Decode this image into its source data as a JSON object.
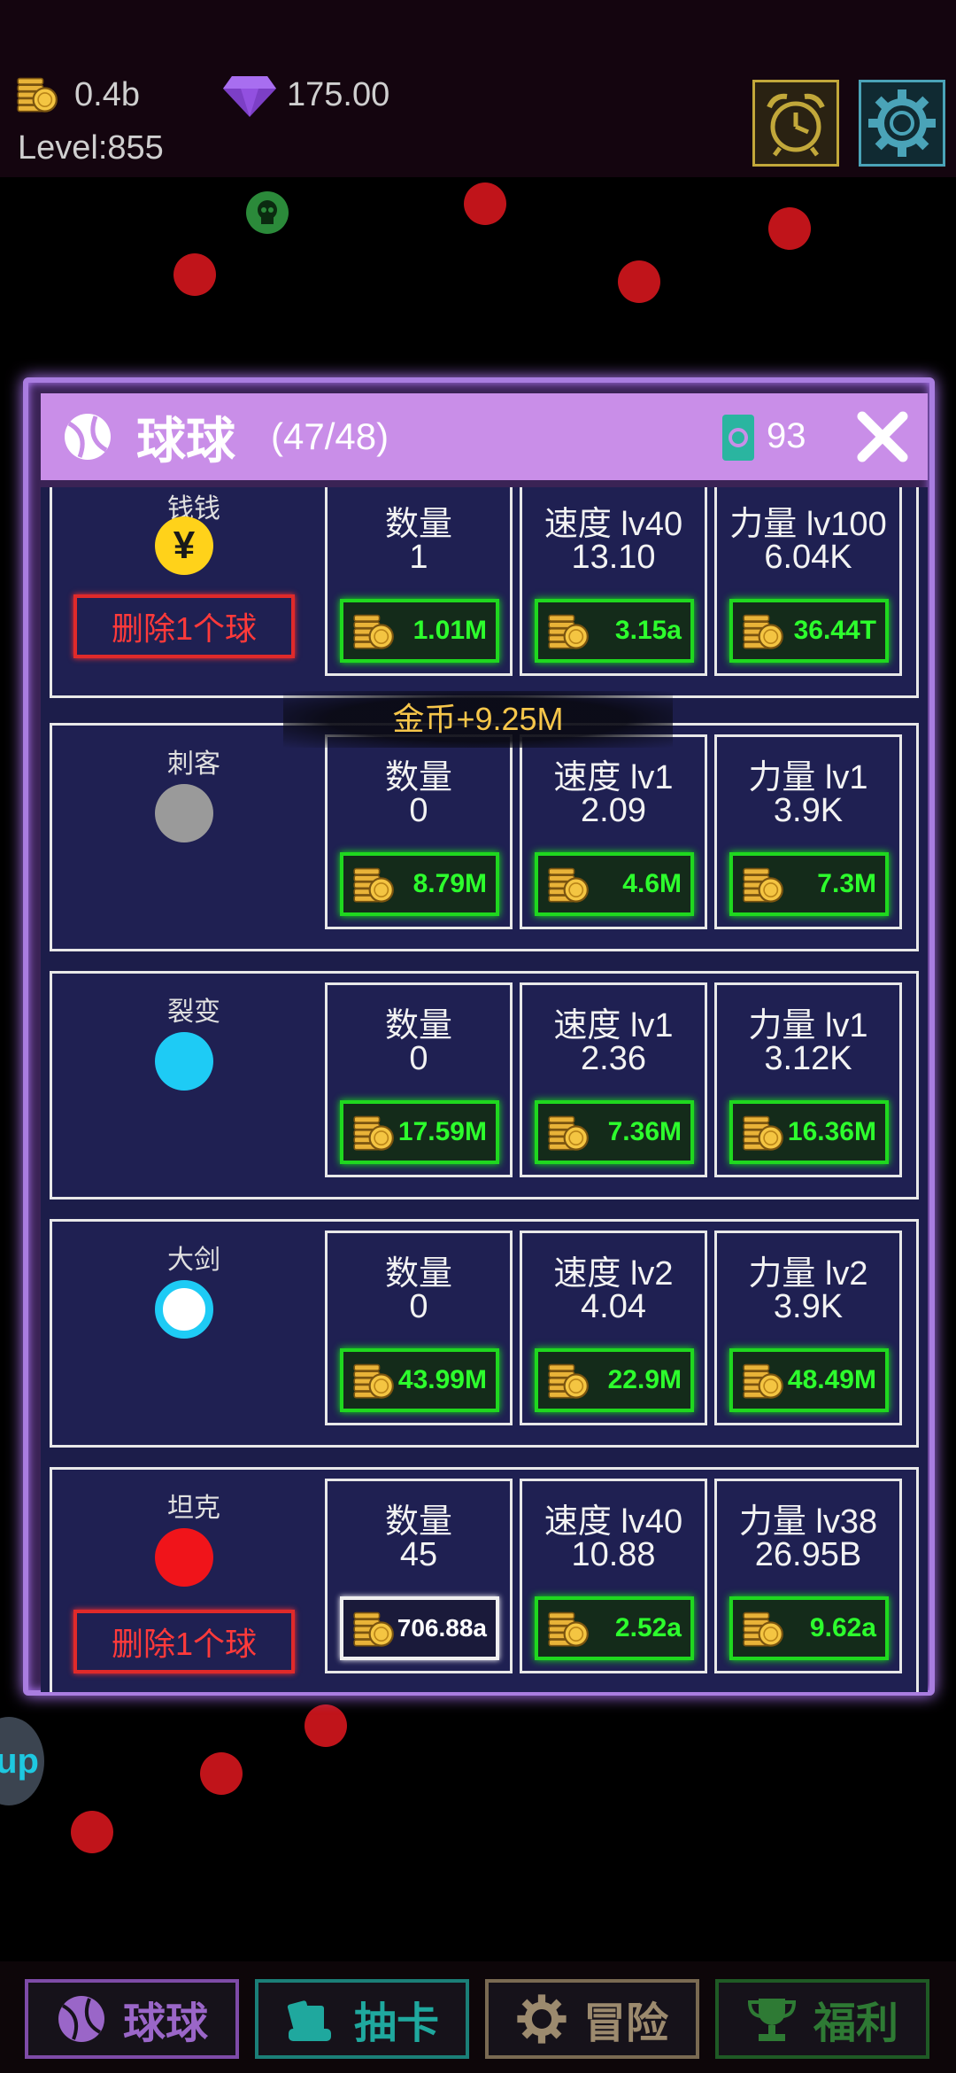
{
  "hud": {
    "coins": "0.4b",
    "gems": "175.00",
    "level": "Level:855",
    "icons": [
      "coin-stack-icon",
      "diamond-icon",
      "alarm-clock-icon",
      "gear-icon"
    ]
  },
  "panel": {
    "title": "球球",
    "count": "(47/48)",
    "card_count": "93",
    "close_icon": "close-icon"
  },
  "floating_reward": "金币+9.25M",
  "balls": [
    {
      "name": "钱钱",
      "color": "#ffd21a",
      "symbol": "¥",
      "delete_label": "删除1个球",
      "qty": {
        "title": "数量",
        "value": "1",
        "price": "1.01M"
      },
      "speed": {
        "title": "速度 lv40",
        "value": "13.10",
        "price": "3.15a"
      },
      "power": {
        "title": "力量 lv100",
        "value": "6.04K",
        "price": "36.44T"
      }
    },
    {
      "name": "刺客",
      "color": "#9a9a9a",
      "symbol": "",
      "delete_label": "",
      "qty": {
        "title": "数量",
        "value": "0",
        "price": "8.79M"
      },
      "speed": {
        "title": "速度 lv1",
        "value": "2.09",
        "price": "4.6M"
      },
      "power": {
        "title": "力量 lv1",
        "value": "3.9K",
        "price": "7.3M"
      }
    },
    {
      "name": "裂变",
      "color": "#1ecbf5",
      "symbol": "",
      "delete_label": "",
      "qty": {
        "title": "数量",
        "value": "0",
        "price": "17.59M"
      },
      "speed": {
        "title": "速度 lv1",
        "value": "2.36",
        "price": "7.36M"
      },
      "power": {
        "title": "力量 lv1",
        "value": "3.12K",
        "price": "16.36M"
      }
    },
    {
      "name": "大剑",
      "color": "#ffffff",
      "symbol": "",
      "delete_label": "",
      "qty": {
        "title": "数量",
        "value": "0",
        "price": "43.99M"
      },
      "speed": {
        "title": "速度 lv2",
        "value": "4.04",
        "price": "22.9M"
      },
      "power": {
        "title": "力量 lv2",
        "value": "3.9K",
        "price": "48.49M"
      }
    },
    {
      "name": "坦克",
      "color": "#f0141a",
      "symbol": "",
      "delete_label": "删除1个球",
      "qty": {
        "title": "数量",
        "value": "45",
        "price": "706.88a"
      },
      "speed": {
        "title": "速度 lv40",
        "value": "10.88",
        "price": "2.52a"
      },
      "power": {
        "title": "力量 lv38",
        "value": "26.95B",
        "price": "9.62a"
      }
    }
  ],
  "side_badge": "up",
  "nav": {
    "balls": "球球",
    "draw": "抽卡",
    "adventure": "冒险",
    "welfare": "福利"
  },
  "colors": {
    "panel_border": "#a97de0",
    "header_bg": "#c98ee8",
    "price_green": "#2dff2d",
    "delete_red": "#ff3a3a",
    "reward_gold": "#f6c64a"
  }
}
